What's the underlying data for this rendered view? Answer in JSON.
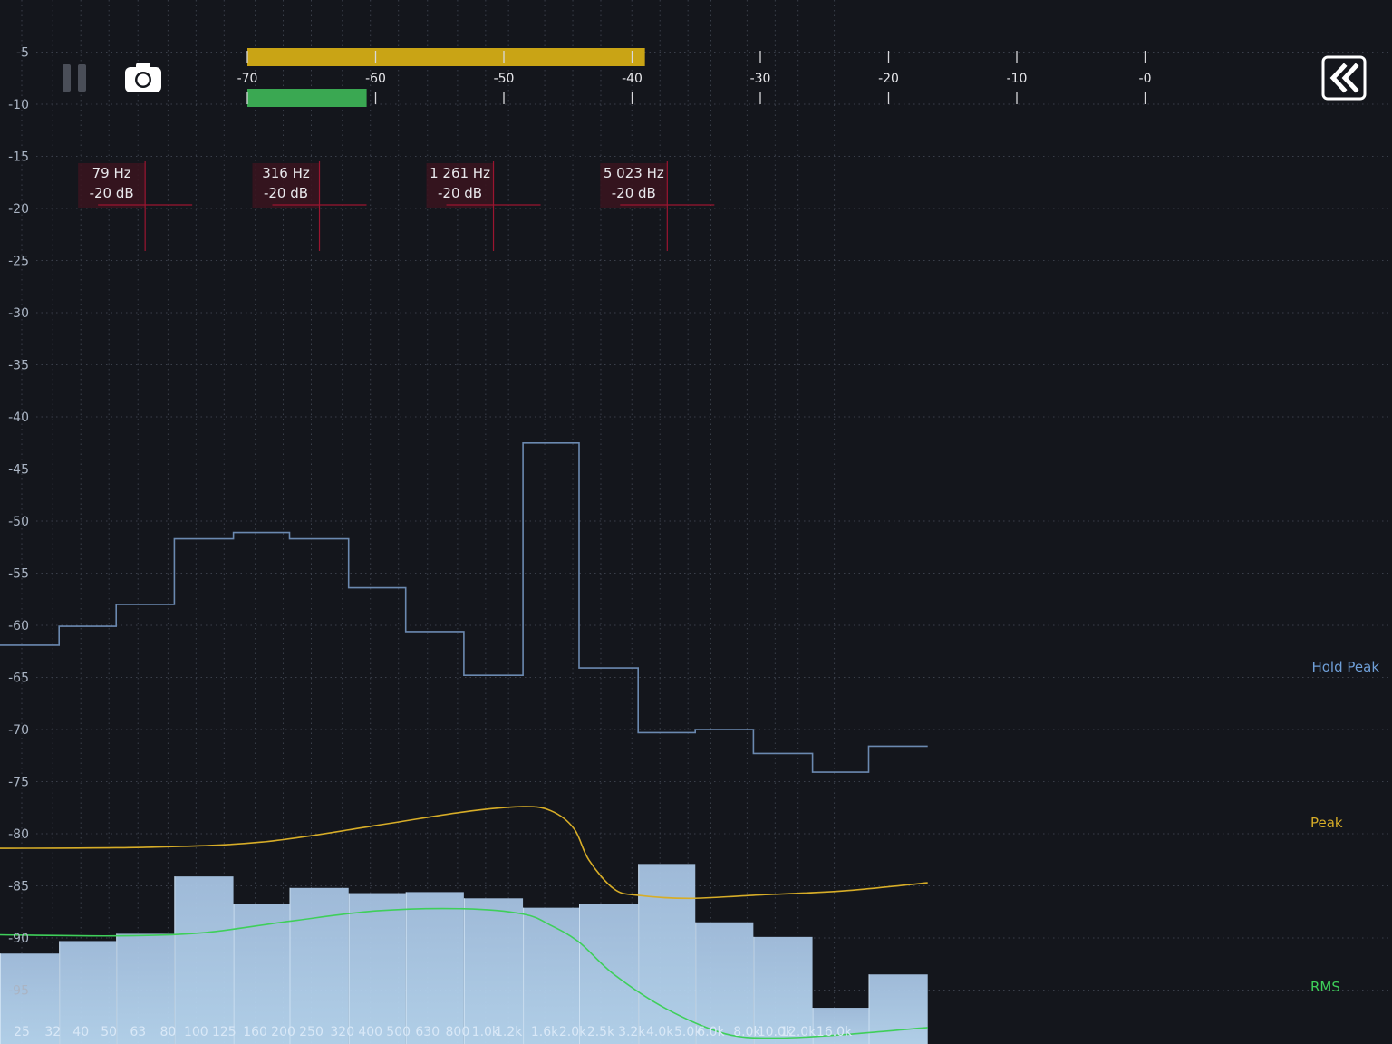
{
  "colors": {
    "background": "#14161c",
    "grid": "#3a3f4a",
    "axis_text": "#aab4c3",
    "peak_bar": "#c9a415",
    "rms_bar": "#3aa852",
    "hold_peak": "#6b89b0",
    "peak_curve": "#d7ad28",
    "rms_curve": "#3fcf5a",
    "bands_top": "#a9c6e6",
    "bands_bottom": "#bcdcf6",
    "marker": "#9b1530",
    "marker_fill": "#3a141f"
  },
  "toolbar": {
    "pause_icon": "pause-icon",
    "camera_icon": "camera-icon",
    "collapse_icon": "double-chevron-left-icon"
  },
  "level_meter": {
    "ticks": [
      "-70",
      "-60",
      "-50",
      "-40",
      "-30",
      "-20",
      "-10",
      "-0"
    ],
    "peak_db": -39,
    "rms_db": -60.7,
    "range": [
      -70,
      0
    ]
  },
  "markers": [
    {
      "freq_label": "79 Hz",
      "db_label": "-20 dB",
      "freq": 79,
      "db": -20
    },
    {
      "freq_label": "316 Hz",
      "db_label": "-20 dB",
      "freq": 316,
      "db": -20
    },
    {
      "freq_label": "1 261 Hz",
      "db_label": "-20 dB",
      "freq": 1261,
      "db": -20
    },
    {
      "freq_label": "5 023 Hz",
      "db_label": "-20 dB",
      "freq": 5023,
      "db": -20
    }
  ],
  "chart_data": {
    "type": "bar",
    "categories": [
      "25",
      "32",
      "40",
      "50",
      "63",
      "80",
      "100",
      "125",
      "160",
      "200",
      "250",
      "320",
      "400",
      "500",
      "630",
      "800",
      "1.0k",
      "1.2k",
      "1.6k",
      "2.0k",
      "2.5k",
      "3.2k",
      "4.0k",
      "5.0k",
      "6.0k",
      "8.0k",
      "10.0k",
      "12.0k",
      "16.0k"
    ],
    "ylim": [
      -100,
      0
    ],
    "y_ticks": [
      "-5",
      "-10",
      "-15",
      "-20",
      "-25",
      "-30",
      "-35",
      "-40",
      "-45",
      "-50",
      "-55",
      "-60",
      "-65",
      "-70",
      "-75",
      "-80",
      "-85",
      "-90",
      "-95"
    ],
    "bands": [
      {
        "lo": 25,
        "hi": 40,
        "rms_db": -91.5,
        "hold_db": -61.9
      },
      {
        "lo": 40,
        "hi": 63,
        "rms_db": -90.3,
        "hold_db": -60.1
      },
      {
        "lo": 63,
        "hi": 100,
        "rms_db": -89.6,
        "hold_db": -58.0
      },
      {
        "lo": 100,
        "hi": 160,
        "rms_db": -84.1,
        "hold_db": -51.7
      },
      {
        "lo": 160,
        "hi": 250,
        "rms_db": -86.7,
        "hold_db": -51.1
      },
      {
        "lo": 250,
        "hi": 400,
        "rms_db": -85.2,
        "hold_db": -51.7
      },
      {
        "lo": 400,
        "hi": 630,
        "rms_db": -85.7,
        "hold_db": -56.4
      },
      {
        "lo": 630,
        "hi": 1000,
        "rms_db": -85.6,
        "hold_db": -60.6
      },
      {
        "lo": 1000,
        "hi": 1600,
        "rms_db": -86.2,
        "hold_db": -64.8
      },
      {
        "lo": 1600,
        "hi": 2500,
        "rms_db": -87.1,
        "hold_db": -42.5
      },
      {
        "lo": 2500,
        "hi": 4000,
        "rms_db": -86.7,
        "hold_db": -64.1
      },
      {
        "lo": 4000,
        "hi": 6300,
        "rms_db": -82.9,
        "hold_db": -70.3
      },
      {
        "lo": 6300,
        "hi": 10000,
        "rms_db": -88.5,
        "hold_db": -70.0
      },
      {
        "lo": 10000,
        "hi": 16000,
        "rms_db": -89.9,
        "hold_db": -72.3
      },
      {
        "lo": 16000,
        "hi": 25000,
        "rms_db": -96.7,
        "hold_db": -74.1
      },
      {
        "lo": 25000,
        "hi": 40000,
        "rms_db": -93.5,
        "hold_db": -71.6
      }
    ],
    "series": [
      {
        "name": "Peak",
        "x": [
          25,
          80,
          200,
          500,
          1000,
          1600,
          2000,
          2400,
          2700,
          3300,
          4000,
          6000,
          10000,
          20000,
          40000
        ],
        "values": [
          -81.4,
          -81.3,
          -80.8,
          -79.2,
          -77.9,
          -77.4,
          -77.8,
          -79.5,
          -82.5,
          -85.3,
          -85.9,
          -86.2,
          -85.9,
          -85.5,
          -84.7
        ]
      },
      {
        "name": "RMS",
        "x": [
          25,
          63,
          125,
          250,
          500,
          1000,
          1600,
          2000,
          2500,
          3300,
          5000,
          8000,
          12000,
          20000,
          40000
        ],
        "values": [
          -89.7,
          -89.8,
          -89.5,
          -88.4,
          -87.4,
          -87.2,
          -87.7,
          -88.8,
          -90.4,
          -93.5,
          -96.8,
          -99.2,
          -99.6,
          -99.3,
          -98.6
        ]
      }
    ],
    "series_labels": {
      "hold": "Hold Peak",
      "peak": "Peak",
      "rms": "RMS"
    }
  }
}
